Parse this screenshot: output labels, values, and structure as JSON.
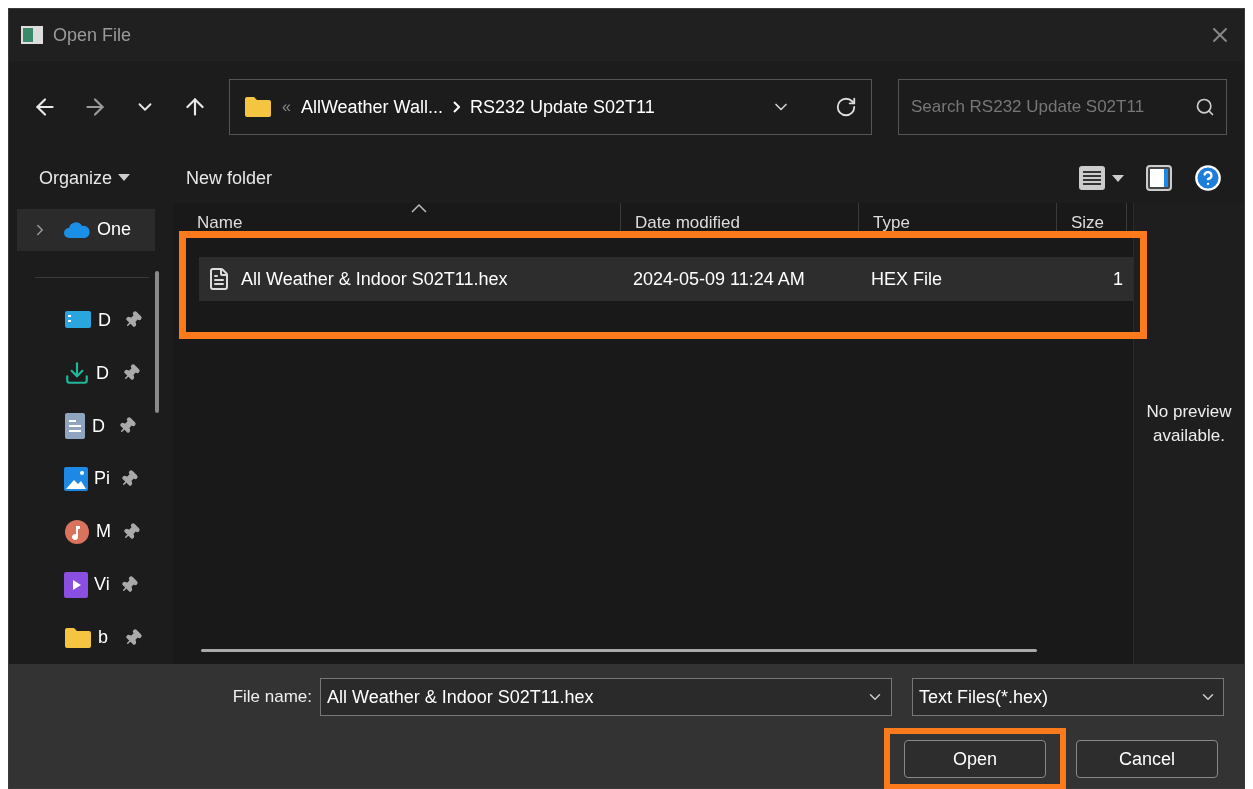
{
  "window": {
    "title": "Open File"
  },
  "address_bar": {
    "overflow": "«",
    "segments": [
      "AllWeather Wall...",
      "RS232 Update S02T11"
    ]
  },
  "search": {
    "placeholder": "Search RS232 Update S02T11"
  },
  "toolbar": {
    "organize": "Organize",
    "new_folder": "New folder"
  },
  "sidebar": {
    "items": [
      {
        "label": "One",
        "kind": "cloud",
        "pinned": false,
        "expanded": false,
        "selected": true
      },
      {
        "label": "D",
        "kind": "desktop",
        "pinned": true,
        "selected": false
      },
      {
        "label": "D",
        "kind": "download",
        "pinned": true,
        "selected": false
      },
      {
        "label": "D",
        "kind": "document",
        "pinned": true,
        "selected": false
      },
      {
        "label": "Pi",
        "kind": "pictures",
        "pinned": true,
        "selected": false
      },
      {
        "label": "M",
        "kind": "music",
        "pinned": true,
        "selected": false
      },
      {
        "label": "Vi",
        "kind": "videos",
        "pinned": true,
        "selected": false
      },
      {
        "label": "b",
        "kind": "folder",
        "pinned": true,
        "selected": false
      }
    ]
  },
  "file_list": {
    "columns": [
      {
        "label": "Name",
        "sorted": true
      },
      {
        "label": "Date modified",
        "sorted": false
      },
      {
        "label": "Type",
        "sorted": false
      },
      {
        "label": "Size",
        "sorted": false
      }
    ],
    "rows": [
      {
        "name": "All Weather & Indoor S02T11.hex",
        "date": "2024-05-09 11:24 AM",
        "type": "HEX File",
        "size": "1",
        "selected": true,
        "annotated": true
      }
    ]
  },
  "preview": {
    "message": "No preview available."
  },
  "file_name": {
    "label": "File name:",
    "value": "All Weather & Indoor S02T11.hex"
  },
  "file_type": {
    "value": "Text Files(*.hex)"
  },
  "buttons": [
    {
      "label": "Open",
      "annotated": true
    },
    {
      "label": "Cancel"
    }
  ]
}
